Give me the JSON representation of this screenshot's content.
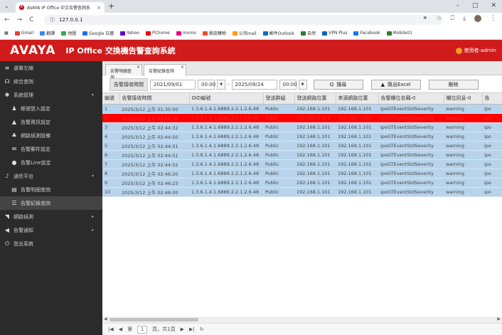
{
  "browser": {
    "tab_title": "AVAYA IP Office 中文告警查詢系",
    "tab_close": "×",
    "new_tab": "+",
    "url": "127.0.0.1",
    "reload": "C",
    "info": "ⓘ"
  },
  "bookmarks": [
    "Gmail",
    "翻譯",
    "地圖",
    "Google 日曆",
    "Yahoo",
    "PChome",
    "momo",
    "蝦皮購物",
    "公司mail",
    "郵件Outlook",
    "自然",
    "VPN Plus",
    "Facebook",
    "Mobile01"
  ],
  "app": {
    "logo": "AVAYA",
    "title": "IP Office 交換機告警查詢系統",
    "user": "使用者-admin"
  },
  "sidebar": [
    {
      "label": "選單左縮",
      "icon": "≡",
      "sub": false,
      "arrow": ""
    },
    {
      "label": "綜合查詢",
      "icon": "☊",
      "sub": false,
      "arrow": ""
    },
    {
      "label": "系統管理",
      "icon": "✱",
      "sub": false,
      "arrow": "▾"
    },
    {
      "label": "帳號登入設定",
      "icon": "♟",
      "sub": true,
      "arrow": ""
    },
    {
      "label": "告警資訊設定",
      "icon": "▲",
      "sub": true,
      "arrow": ""
    },
    {
      "label": "網路偵測設備",
      "icon": "♣",
      "sub": true,
      "arrow": ""
    },
    {
      "label": "告警郵件設定",
      "icon": "✉",
      "sub": true,
      "arrow": ""
    },
    {
      "label": "告警Line設定",
      "icon": "●",
      "sub": true,
      "arrow": ""
    },
    {
      "label": "通信平台",
      "icon": "♪",
      "sub": false,
      "arrow": "▾"
    },
    {
      "label": "告警明細查詢",
      "icon": "▤",
      "sub": true,
      "arrow": ""
    },
    {
      "label": "告警紀錄查詢",
      "icon": "☰",
      "sub": true,
      "arrow": "",
      "active": true
    },
    {
      "label": "網路偵測",
      "icon": "◥",
      "sub": false,
      "arrow": "▸"
    },
    {
      "label": "告警通知",
      "icon": "◀",
      "sub": false,
      "arrow": "▸"
    },
    {
      "label": "登出系統",
      "icon": "⏻",
      "sub": false,
      "arrow": ""
    }
  ],
  "page_tabs": [
    {
      "label": "告警明細查詢",
      "close": "×"
    },
    {
      "label": "告警紀錄查詢",
      "close": "×"
    }
  ],
  "filters": {
    "label": "告警接收時間",
    "start_date": "2021/09/01",
    "start_time": "00:00",
    "sep": "-",
    "end_date": "2025/09/24",
    "end_time": "00:00",
    "search": "搜尋",
    "export": "匯出Excel",
    "delete": "刪除",
    "search_icon": "Q",
    "export_icon": "▲"
  },
  "table": {
    "headers": [
      "編號",
      "告警接收時間",
      "OID編號",
      "發送群組",
      "發送網路位置",
      "來源網路位置",
      "告警欄位名稱-0",
      "欄位訊息-0",
      "告"
    ],
    "rows": [
      [
        "1",
        "2025/3/12 上午 01:35:00",
        "1.3.6.1.4.1.6889.2.2.1.2.6.48",
        "Public",
        "192.168.1.101",
        "192.168.1.101",
        "ipoGTEventStdSeverity",
        "warning",
        "ipo"
      ],
      [
        "2",
        "2025/3/12 上午 02:44:30",
        "1.3.6.1.4.1.6889.2.2.1.2.6.48",
        "Public",
        "192.168.1.101",
        "192.168.1.101",
        "ipoGTEventStdSeverity",
        "warning",
        "ipo"
      ],
      [
        "3",
        "2025/3/12 上午 02:44:32",
        "1.3.6.1.4.1.6889.2.2.1.2.6.48",
        "Public",
        "192.168.1.101",
        "192.168.1.101",
        "ipoGTEventStdSeverity",
        "warning",
        "ipo"
      ],
      [
        "4",
        "2025/3/12 上午 02:44:50",
        "1.3.6.1.4.1.6889.2.2.1.2.6.48",
        "Public",
        "192.168.1.101",
        "192.168.1.101",
        "ipoGTEventStdSeverity",
        "warning",
        "ipo"
      ],
      [
        "5",
        "2025/3/12 上午 02:44:51",
        "1.3.6.1.4.1.6889.2.2.1.2.6.48",
        "Public",
        "192.168.1.101",
        "192.168.1.101",
        "ipoGTEventStdSeverity",
        "warning",
        "ipo"
      ],
      [
        "6",
        "2025/3/12 上午 02:44:51",
        "1.3.6.1.4.1.6889.2.2.1.2.6.48",
        "Public",
        "192.168.1.101",
        "192.168.1.101",
        "ipoGTEventStdSeverity",
        "warning",
        "ipo"
      ],
      [
        "7",
        "2025/3/12 上午 02:44:52",
        "1.3.6.1.4.1.6889.2.2.1.2.6.48",
        "Public",
        "192.168.1.101",
        "192.168.1.101",
        "ipoGTEventStdSeverity",
        "warning",
        "ipo"
      ],
      [
        "8",
        "2025/3/12 上午 02:46:20",
        "1.3.6.1.4.1.6889.2.2.1.2.6.48",
        "Public",
        "192.168.1.101",
        "192.168.1.101",
        "ipoGTEventStdSeverity",
        "warning",
        "ipo"
      ],
      [
        "9",
        "2025/3/12 上午 02:46:23",
        "1.3.6.1.4.1.6889.2.2.1.2.6.48",
        "Public",
        "192.168.1.101",
        "192.168.1.101",
        "ipoGTEventStdSeverity",
        "warning",
        "ipo"
      ],
      [
        "10",
        "2025/3/12 上午 02:48:00",
        "1.3.6.1.4.1.6889.2.2.1.2.6.48",
        "Public",
        "192.168.1.101",
        "192.168.1.101",
        "ipoGTEventStdSeverity",
        "warning",
        "ipo"
      ]
    ]
  },
  "pager": {
    "first": "|◀",
    "prev": "◀",
    "page_label": "第",
    "page": "1",
    "of": "頁，共1頁",
    "next": "▶",
    "last": "▶|",
    "refresh": "↻"
  },
  "colors": {
    "brand_red": "#cf1b1b",
    "row_blue": "#b7d4ec",
    "highlight_red": "#ff0000",
    "sidebar_bg": "#2b2b2b"
  }
}
